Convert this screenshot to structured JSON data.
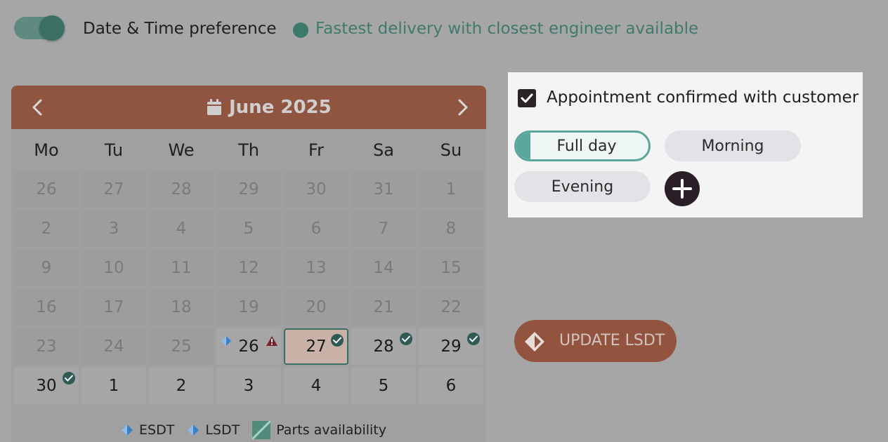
{
  "header": {
    "toggle_on": true,
    "preference_label": "Date & Time preference",
    "fastest_label": "Fastest delivery with closest engineer available"
  },
  "calendar": {
    "month_label": "June 2025",
    "weekdays": [
      "Mo",
      "Tu",
      "We",
      "Th",
      "Fr",
      "Sa",
      "Su"
    ],
    "weeks": [
      [
        "26",
        "27",
        "28",
        "29",
        "30",
        "31",
        "1"
      ],
      [
        "2",
        "3",
        "4",
        "5",
        "6",
        "7",
        "8"
      ],
      [
        "9",
        "10",
        "11",
        "12",
        "13",
        "14",
        "15"
      ],
      [
        "16",
        "17",
        "18",
        "19",
        "20",
        "21",
        "22"
      ],
      [
        "23",
        "24",
        "25",
        "26",
        "27",
        "28",
        "29"
      ],
      [
        "30",
        "1",
        "2",
        "3",
        "4",
        "5",
        "6"
      ]
    ],
    "selected_day": "27",
    "available_days": [
      "26",
      "27",
      "28",
      "29",
      "30"
    ],
    "checked_days": [
      "27",
      "28",
      "29",
      "30"
    ],
    "warning_days": [
      "26"
    ],
    "lsdt_day": "26"
  },
  "legend": {
    "esdt": "ESDT",
    "lsdt": "LSDT",
    "parts": "Parts availability"
  },
  "appointment": {
    "confirmed_label": "Appointment confirmed with customer",
    "confirmed": true,
    "slots": [
      "Full day",
      "Morning",
      "Evening"
    ],
    "selected_slot": "Full day"
  },
  "actions": {
    "update_label": "UPDATE LSDT"
  },
  "colors": {
    "brand": "#8f5540",
    "accent": "#3a7a6b",
    "check": "#2f5a54",
    "warning": "#7a1f2b",
    "diamond": "#3d7fc4"
  }
}
